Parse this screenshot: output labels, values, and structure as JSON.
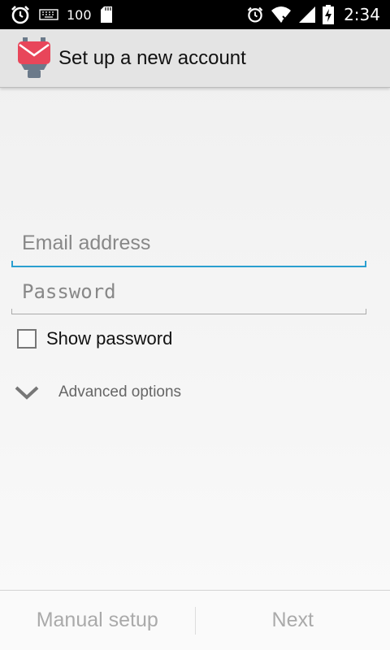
{
  "status_bar": {
    "battery_level": "100",
    "time": "2:34"
  },
  "header": {
    "title": "Set up a new account"
  },
  "form": {
    "email_placeholder": "Email address",
    "password_placeholder": "Password",
    "show_password_label": "Show password",
    "advanced_options_label": "Advanced options"
  },
  "footer": {
    "manual_setup_label": "Manual setup",
    "next_label": "Next"
  },
  "colors": {
    "accent": "#2a9fd0",
    "app_icon": "#e8465a"
  }
}
